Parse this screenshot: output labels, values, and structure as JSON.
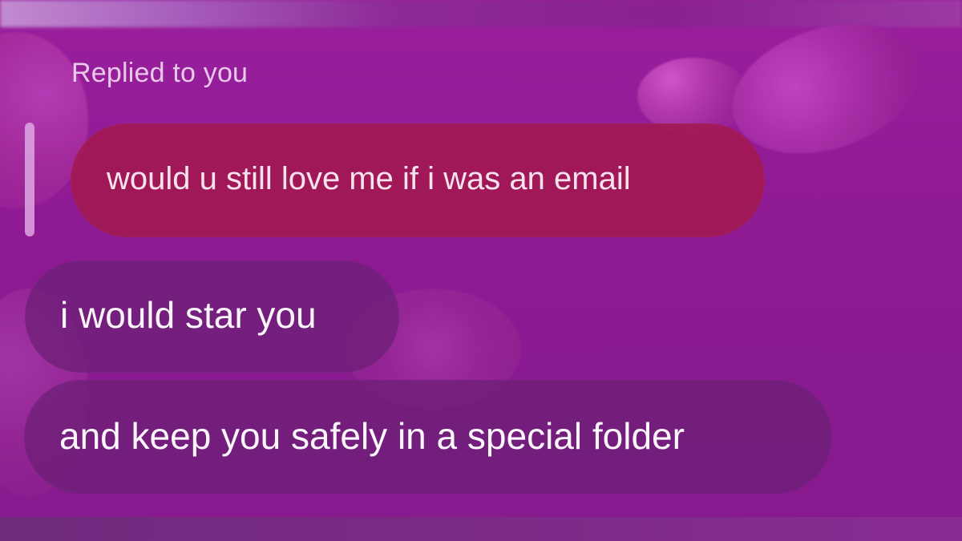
{
  "conversation": {
    "reply_label": "Replied to you",
    "quoted_message": "would u still love me if i was an email",
    "messages": [
      "i would star you",
      "and keep you safely in a special folder"
    ]
  },
  "colors": {
    "background": "#8d1a93",
    "quoted_bubble": "#a21850",
    "message_bubble": "#6d1f76",
    "reply_indicator": "#e1ace5",
    "text": "#fbf6fb"
  }
}
